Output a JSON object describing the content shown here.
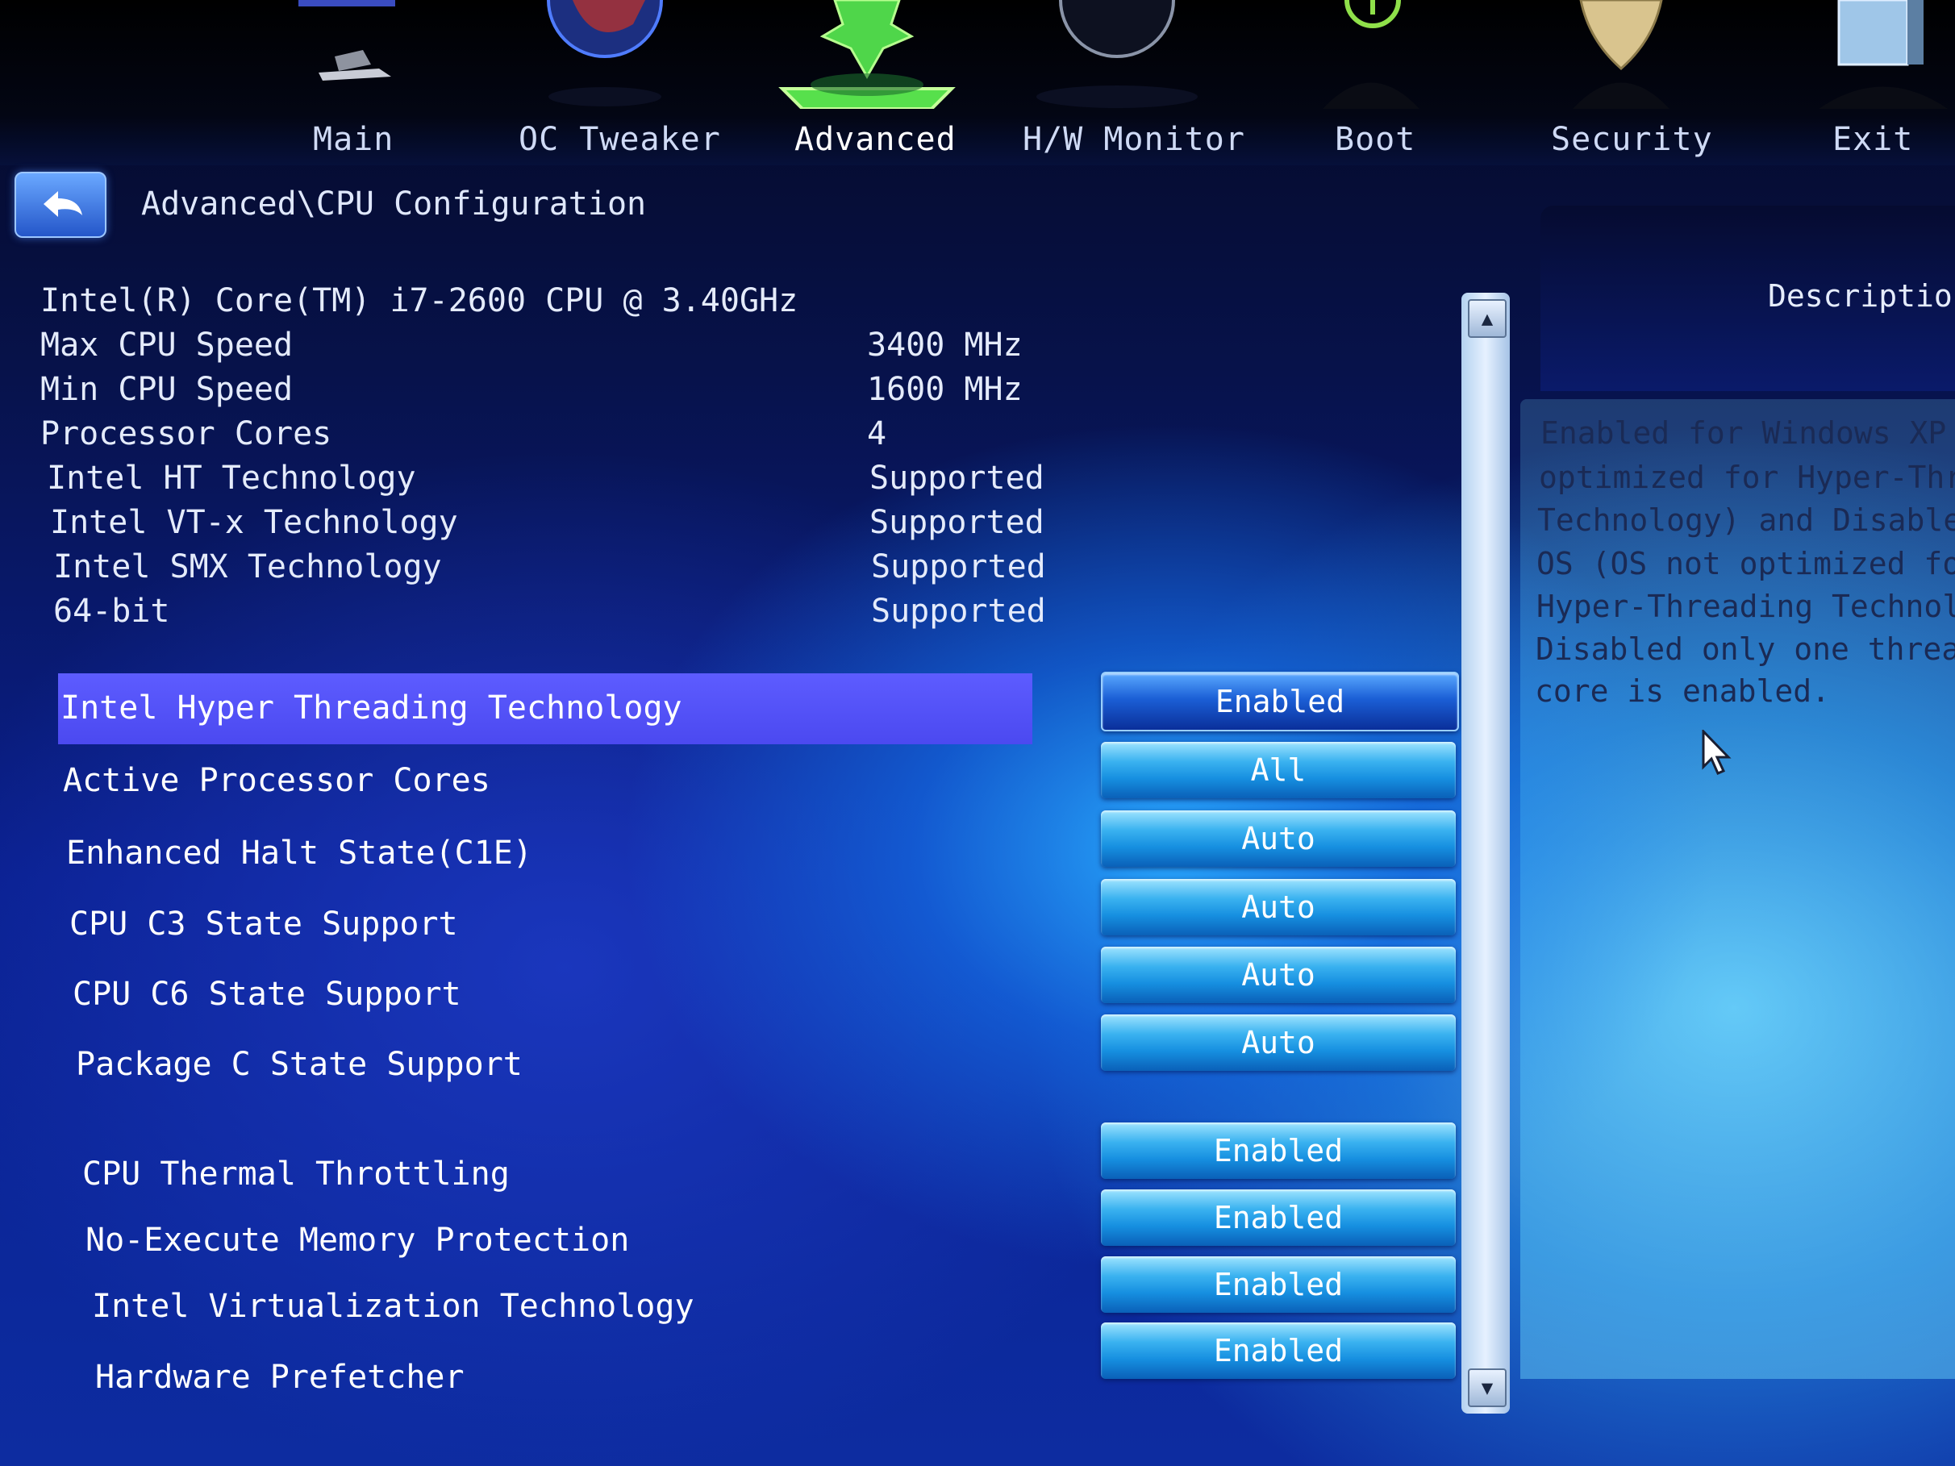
{
  "nav": {
    "tabs": [
      {
        "label": "Main",
        "icon": "computer-icon"
      },
      {
        "label": "OC Tweaker",
        "icon": "globe-icon"
      },
      {
        "label": "Advanced",
        "icon": "star-icon",
        "active": true
      },
      {
        "label": "H/W Monitor",
        "icon": "monitor-icon"
      },
      {
        "label": "Boot",
        "icon": "power-icon"
      },
      {
        "label": "Security",
        "icon": "shield-icon"
      },
      {
        "label": "Exit",
        "icon": "door-icon"
      }
    ]
  },
  "breadcrumb": "Advanced\\CPU Configuration",
  "cpu_info": {
    "model": "Intel(R) Core(TM) i7-2600 CPU @ 3.40GHz",
    "rows": [
      {
        "label": "Max CPU Speed",
        "value": "3400 MHz"
      },
      {
        "label": "Min CPU Speed",
        "value": "1600 MHz"
      },
      {
        "label": "Processor Cores",
        "value": "4"
      },
      {
        "label": "Intel HT Technology",
        "value": "Supported"
      },
      {
        "label": "Intel VT-x Technology",
        "value": "Supported"
      },
      {
        "label": "Intel SMX Technology",
        "value": "Supported"
      },
      {
        "label": "64-bit",
        "value": "Supported"
      }
    ]
  },
  "settings": [
    {
      "label": "Intel Hyper Threading Technology",
      "value": "Enabled",
      "selected": true
    },
    {
      "label": "Active Processor Cores",
      "value": "All"
    },
    {
      "label": "Enhanced Halt State(C1E)",
      "value": "Auto"
    },
    {
      "label": "CPU C3 State Support",
      "value": "Auto"
    },
    {
      "label": "CPU C6 State Support",
      "value": "Auto"
    },
    {
      "label": "Package C State Support",
      "value": "Auto"
    },
    {
      "label": "CPU Thermal Throttling",
      "value": "Enabled"
    },
    {
      "label": "No-Execute Memory Protection",
      "value": "Enabled"
    },
    {
      "label": "Intel Virtualization Technology",
      "value": "Enabled"
    },
    {
      "label": "Hardware Prefetcher",
      "value": "Enabled"
    }
  ],
  "description": {
    "title": "Description",
    "lines": [
      "Enabled for Windows XP ar",
      "optimized for Hyper-Threa",
      "Technology) and Disabled",
      "OS (OS not optimized for",
      "Hyper-Threading Technolog",
      "Disabled only one thread",
      "core is enabled."
    ]
  },
  "colors": {
    "highlight": "#5d5cff",
    "button": "#168fe0",
    "background": "#0a2090"
  }
}
